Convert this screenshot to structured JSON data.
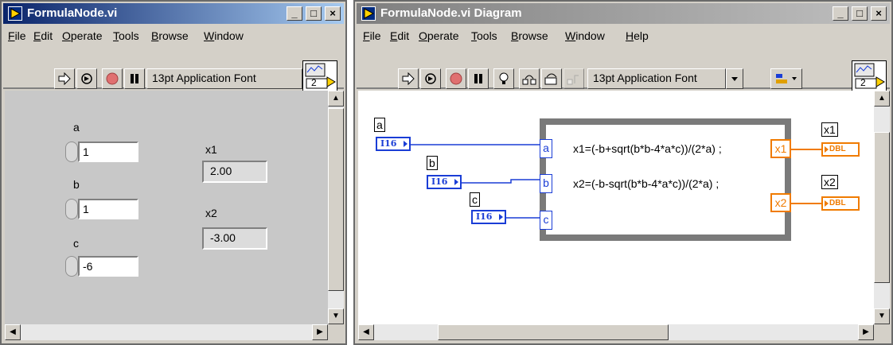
{
  "front_panel": {
    "title": "FormulaNode.vi",
    "menu": [
      "File",
      "Edit",
      "Operate",
      "Tools",
      "Browse",
      "Window"
    ],
    "font_selector": "13pt Application Font",
    "connector_label": "2",
    "controls": [
      {
        "label": "a",
        "value": "1"
      },
      {
        "label": "b",
        "value": "1"
      },
      {
        "label": "c",
        "value": "-6"
      }
    ],
    "indicators": [
      {
        "label": "x1",
        "value": "2.00"
      },
      {
        "label": "x2",
        "value": "-3.00"
      }
    ]
  },
  "block_diagram": {
    "title": "FormulaNode.vi Diagram",
    "menu": [
      "File",
      "Edit",
      "Operate",
      "Tools",
      "Browse",
      "Window",
      "Help"
    ],
    "font_selector": "13pt Application Font",
    "connector_label": "2",
    "inputs": [
      {
        "label": "a",
        "type": "I16"
      },
      {
        "label": "b",
        "type": "I16"
      },
      {
        "label": "c",
        "type": "I16"
      }
    ],
    "formula_node": {
      "inputs": [
        "a",
        "b",
        "c"
      ],
      "outputs": [
        "x1",
        "x2"
      ],
      "lines": [
        "x1=(-b+sqrt(b*b-4*a*c))/(2*a) ;",
        "x2=(-b-sqrt(b*b-4*a*c))/(2*a) ;"
      ]
    },
    "outputs": [
      {
        "label": "x1",
        "type": "DBL"
      },
      {
        "label": "x2",
        "type": "DBL"
      }
    ]
  },
  "colors": {
    "wire_int": "#1a3dd6",
    "wire_dbl": "#f07b00",
    "panel_bg": "#c8c8c8",
    "active_title": "#0a246a"
  }
}
